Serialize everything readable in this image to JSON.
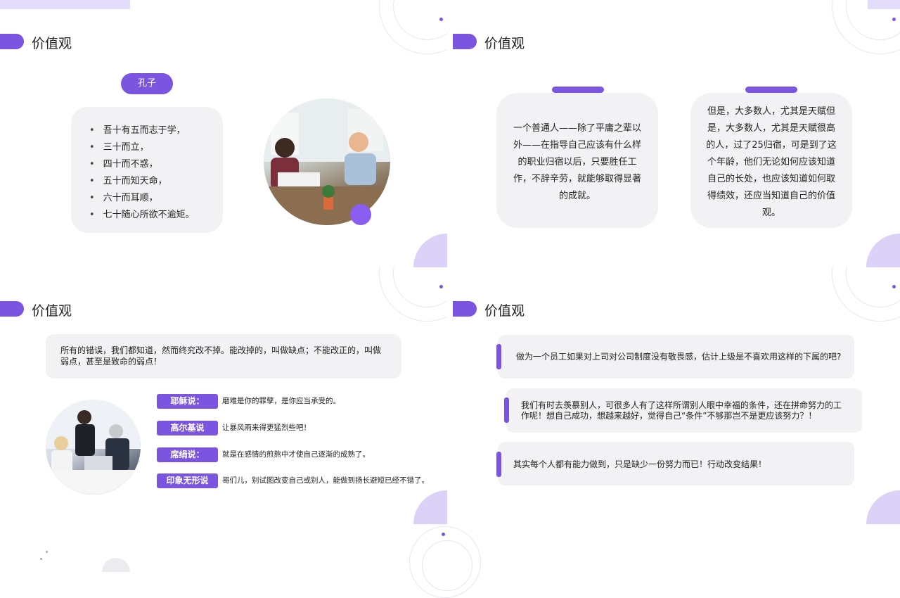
{
  "slides": [
    {
      "title": "价值观",
      "tag": "孔子",
      "items": [
        "吾十有五而志于学，",
        "三十而立，",
        "四十而不惑，",
        "五十而知天命，",
        "六十而耳顺，",
        "七十随心所欲不逾矩。"
      ]
    },
    {
      "title": "价值观",
      "cards": [
        "一个普通人——除了平庸之辈以外——在指导自己应该有什么样的职业归宿以后，只要胜任工作，不辞辛劳，就能够取得显著的成就。",
        "但是，大多数人，尤其是天赋但是，大多数人，尤其是天赋很高的人，过了25归宿，可是到了这个年龄，他们无论如何应该知道自己的长处，也应该知道如何取得绩效，还应当知道自己的价值观。"
      ]
    },
    {
      "title": "价值观",
      "quote": "所有的错误，我们都知道，然而终究改不掉。能改掉的，叫做缺点；不能改正的，叫做弱点，甚至是致命的弱点！",
      "sayings": [
        {
          "label": "耶稣说：",
          "text": "磨难是你的罪孽，是你应当承受的。"
        },
        {
          "label": "高尔基说",
          "text": "让暴风雨来得更猛烈些吧！"
        },
        {
          "label": "席绢说：",
          "text": "就是在感情的煎熬中才使自己逐渐的成熟了。"
        },
        {
          "label": "印象无形说",
          "text": "哥们儿，别试图改变自己或别人，能做到扬长避短已经不错了。"
        }
      ]
    },
    {
      "title": "价值观",
      "boxes": [
        "做为一个员工如果对上司对公司制度没有敬畏感，估计上级是不喜欢用这样的下属的吧?",
        "我们有时去羡慕别人，可很多人有了这样所谓别人眼中幸福的条件，还在拼命努力的工作呢！想自己成功，想越来越好，觉得自己“条件”不够那岂不是更应该努力？！",
        "其实每个人都有能力做到，只是缺少一份努力而已！行动改变结果！"
      ]
    }
  ],
  "colors": {
    "accent": "#7b55e0",
    "card": "#f2f2f4",
    "soft": "#dcd2f8"
  },
  "icons": [
    "bullet-icon",
    "ring-decoration",
    "dot-decoration"
  ]
}
